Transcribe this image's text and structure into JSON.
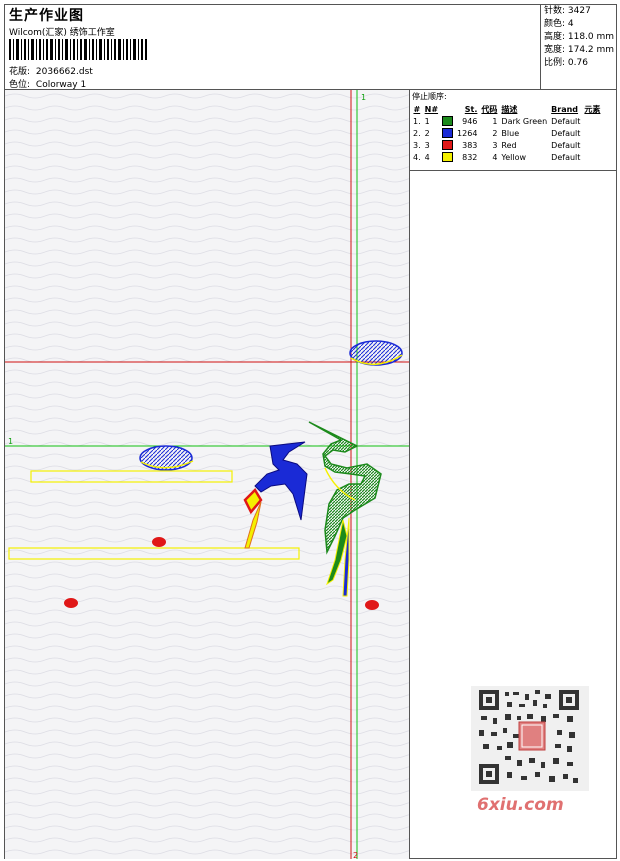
{
  "header": {
    "title": "生产作业图",
    "subtitle": "Wilcom(汇家) 绣饰工作室",
    "design_label": "花版:",
    "design_value": "2036662.dst",
    "colorway_label": "色位:",
    "colorway_value": "Colorway 1"
  },
  "stats": {
    "stitches": "针数: 3427",
    "colors": "颜色: 4",
    "height": "高度: 118.0 mm",
    "width": "宽度: 174.2 mm",
    "scale": "比例: 0.76"
  },
  "canvas": {
    "marker_1_top": "1",
    "marker_1_left": "1",
    "marker_2_bottom": "2"
  },
  "stop_sequence": {
    "label": "停止顺序:",
    "headers": [
      "#",
      "N#",
      "St.",
      "代码",
      "描述",
      "Brand",
      "元素"
    ],
    "rows": [
      {
        "idx": "1.",
        "n": "1",
        "color": "#1c8a1c",
        "st": "946",
        "code": "1",
        "desc": "Dark Green",
        "brand": "Default"
      },
      {
        "idx": "2.",
        "n": "2",
        "color": "#1a2ad6",
        "st": "1264",
        "code": "2",
        "desc": "Blue",
        "brand": "Default"
      },
      {
        "idx": "3.",
        "n": "3",
        "color": "#e01818",
        "st": "383",
        "code": "3",
        "desc": "Red",
        "brand": "Default"
      },
      {
        "idx": "4.",
        "n": "4",
        "color": "#f4f000",
        "st": "832",
        "code": "4",
        "desc": "Yellow",
        "brand": "Default"
      }
    ]
  },
  "watermark": {
    "site": "6xiu.com"
  },
  "colors": {
    "green": "#1c8a1c",
    "blue": "#1a2ad6",
    "red": "#e01818",
    "yellow": "#f4f000",
    "guide_red": "#d01010",
    "guide_green": "#10c010"
  }
}
